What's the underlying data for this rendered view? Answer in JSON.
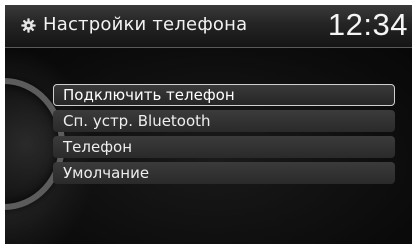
{
  "header": {
    "icon": "gear-icon",
    "title": "Настройки телефона",
    "clock": "12:34"
  },
  "menu": {
    "items": [
      {
        "label": "Подключить телефон",
        "selected": true
      },
      {
        "label": "Сп. устр. Bluetooth",
        "selected": false
      },
      {
        "label": "Телефон",
        "selected": false
      },
      {
        "label": "Умолчание",
        "selected": false
      }
    ]
  },
  "colors": {
    "background": "#050505",
    "text": "#eeeeee",
    "selection_border": "#cfcfcf"
  }
}
